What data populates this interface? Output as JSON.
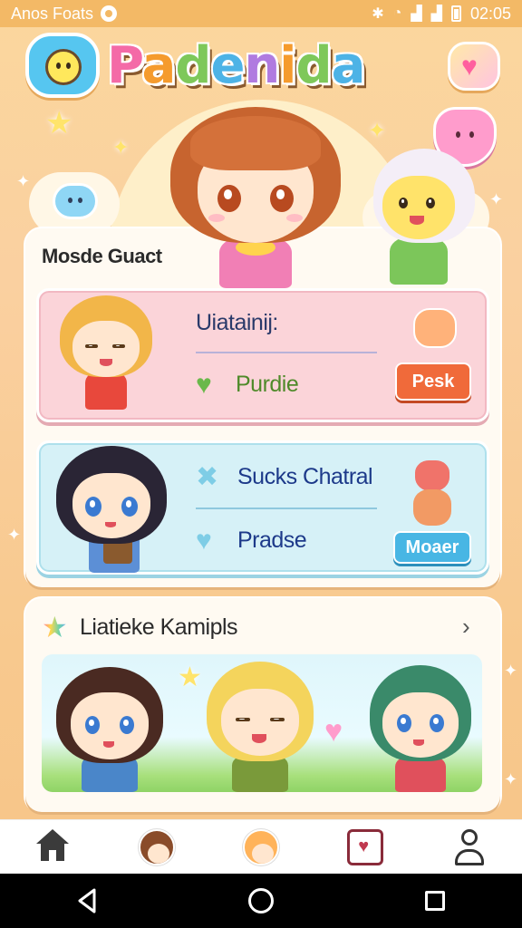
{
  "status_bar": {
    "carrier": "Anos Foats",
    "time": "02:05",
    "icons": [
      "bluetooth-icon",
      "wifi-icon",
      "signal-icon",
      "signal-icon",
      "battery-icon"
    ]
  },
  "header": {
    "title_parts": [
      "P",
      "a",
      "d",
      "e",
      "n",
      "i",
      "d",
      "a"
    ],
    "title": "Padenida",
    "logo_icon": "smiley-bug-icon",
    "badge_icon": "heart-icon"
  },
  "main": {
    "section_title": "Mosde Guact",
    "cards": [
      {
        "heading": "Uiatainij:",
        "row_label": "Purdie",
        "row_icon": "heart-icon",
        "button_label": "Pesk",
        "pet_icon": "critter-icon"
      },
      {
        "heading": "Sucks Chatral",
        "heading_icon": "cross-icon",
        "row_label": "Pradse",
        "row_icon": "heart-icon",
        "button_label": "Moaer",
        "pet_icon": "cat-icon"
      }
    ]
  },
  "lower": {
    "title": "Liatieke Kamipls",
    "title_icon": "star-icon",
    "chevron": "›"
  },
  "bottom_nav": {
    "items": [
      "home-icon",
      "avatar-icon",
      "avatar-icon",
      "frame-icon",
      "profile-icon"
    ]
  },
  "colors": {
    "background": "#f8c98e",
    "status_bar": "#f3b966",
    "pink_card": "#fbd4d9",
    "blue_card": "#d6f1f7",
    "peek_button": "#f06a3a",
    "more_button": "#48b6e4"
  }
}
